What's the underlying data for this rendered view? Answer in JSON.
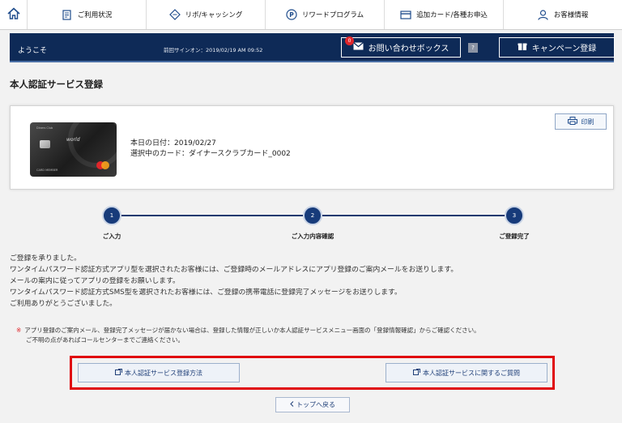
{
  "nav": {
    "items": [
      {
        "label": "ご利用状況",
        "icon": "document-icon"
      },
      {
        "label": "リボ/キャッシング",
        "icon": "diamond-arrows-icon"
      },
      {
        "label": "リワードプログラム",
        "icon": "p-circle-icon"
      },
      {
        "label": "追加カード/各種お申込",
        "icon": "card-icon"
      },
      {
        "label": "お客様情報",
        "icon": "user-icon"
      }
    ]
  },
  "header": {
    "welcome": "ようこそ",
    "last_signin": "前回サインオン：2019/02/19 AM 09:52",
    "inbox_label": "お問い合わせボックス",
    "inbox_count": "0",
    "help": "?",
    "campaign_label": "キャンペーン登録",
    "bg_color": "#0e2a57"
  },
  "page_title": "本人認証サービス登録",
  "card_panel": {
    "card_text_world": "world",
    "card_text_top": "Diners Club",
    "card_text_member": "CARD MEMBER",
    "date_line": "本日の日付：2019/02/27",
    "card_line": "選択中のカード：ダイナースクラブカード_0002",
    "print_label": "印刷"
  },
  "steps": [
    {
      "num": "1",
      "label": "ご入力"
    },
    {
      "num": "2",
      "label": "ご入力内容確認"
    },
    {
      "num": "3",
      "label": "ご登録完了"
    }
  ],
  "message_lines": [
    "ご登録を承りました。",
    "ワンタイムパスワード認証方式アプリ型を選択されたお客様には、ご登録時のメールアドレスにアプリ登録のご案内メールをお送りします。",
    "メールの案内に従ってアプリの登録をお願いします。",
    "ワンタイムパスワード認証方式SMS型を選択されたお客様には、ご登録の携帯電話に登録完了メッセージをお送りします。",
    "ご利用ありがとうございました。"
  ],
  "note": {
    "mark": "※",
    "line1": "アプリ登録のご案内メール、登録完了メッセージが届かない場合は、登録した情報が正しいか本人認証サービスメニュー画面の「登録情報確認」からご確認ください。",
    "line2": "ご不明の点があればコールセンターまでご連絡ください。"
  },
  "links": {
    "howto": "本人認証サービス登録方法",
    "faq": "本人認証サービスに関するご質問",
    "back_top": "トップへ戻る"
  }
}
